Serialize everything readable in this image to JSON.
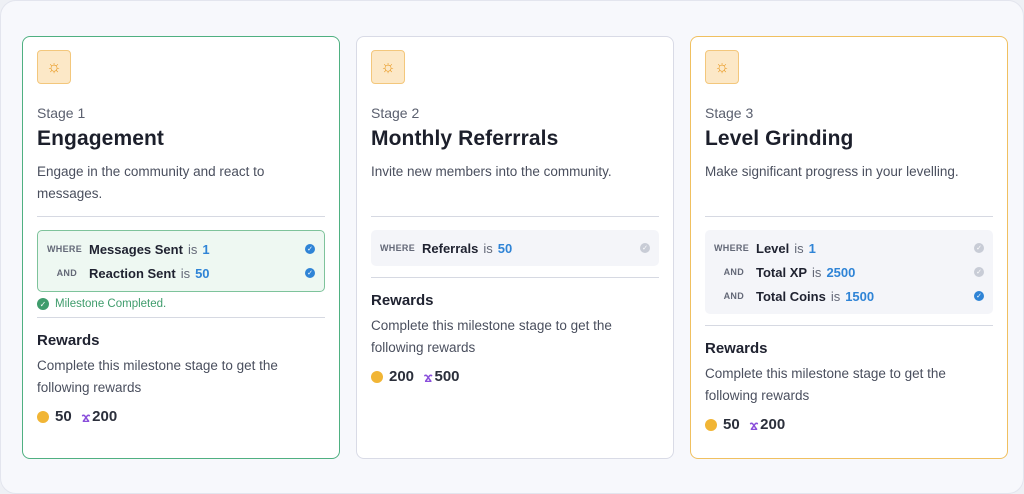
{
  "stages": [
    {
      "stage_label": "Stage 1",
      "title": "Engagement",
      "description": "Engage in the community and react to messages.",
      "conditions": [
        {
          "keyword": "WHERE",
          "field": "Messages Sent",
          "op": "is",
          "value": "1",
          "met": true
        },
        {
          "keyword": "AND",
          "field": "Reaction Sent",
          "op": "is",
          "value": "50",
          "met": true
        }
      ],
      "milestone_text": "Milestone Completed.",
      "rewards_title": "Rewards",
      "rewards_desc": "Complete this milestone stage to get the following rewards",
      "coins": "50",
      "xp": "200"
    },
    {
      "stage_label": "Stage 2",
      "title": "Monthly Referrrals",
      "description": "Invite new members into the community.",
      "conditions": [
        {
          "keyword": "WHERE",
          "field": "Referrals",
          "op": "is",
          "value": "50",
          "met": false
        }
      ],
      "rewards_title": "Rewards",
      "rewards_desc": "Complete this milestone stage to get the following rewards",
      "coins": "200",
      "xp": "500"
    },
    {
      "stage_label": "Stage 3",
      "title": "Level Grinding",
      "description": "Make significant progress in your levelling.",
      "conditions": [
        {
          "keyword": "WHERE",
          "field": "Level",
          "op": "is",
          "value": "1",
          "met": false
        },
        {
          "keyword": "AND",
          "field": "Total XP",
          "op": "is",
          "value": "2500",
          "met": false
        },
        {
          "keyword": "AND",
          "field": "Total Coins",
          "op": "is",
          "value": "1500",
          "met": true
        }
      ],
      "rewards_title": "Rewards",
      "rewards_desc": "Complete this milestone stage to get the following rewards",
      "coins": "50",
      "xp": "200"
    }
  ],
  "icons": {
    "stage": "sun-icon",
    "coin": "coin-icon",
    "xp": "xp-icon",
    "check": "check-circle-icon"
  },
  "colors": {
    "completed_border": "#4fb081",
    "active_border": "#f0c060",
    "value_blue": "#2f84d6",
    "coin": "#f1b535",
    "xp": "#8a4fdb"
  }
}
